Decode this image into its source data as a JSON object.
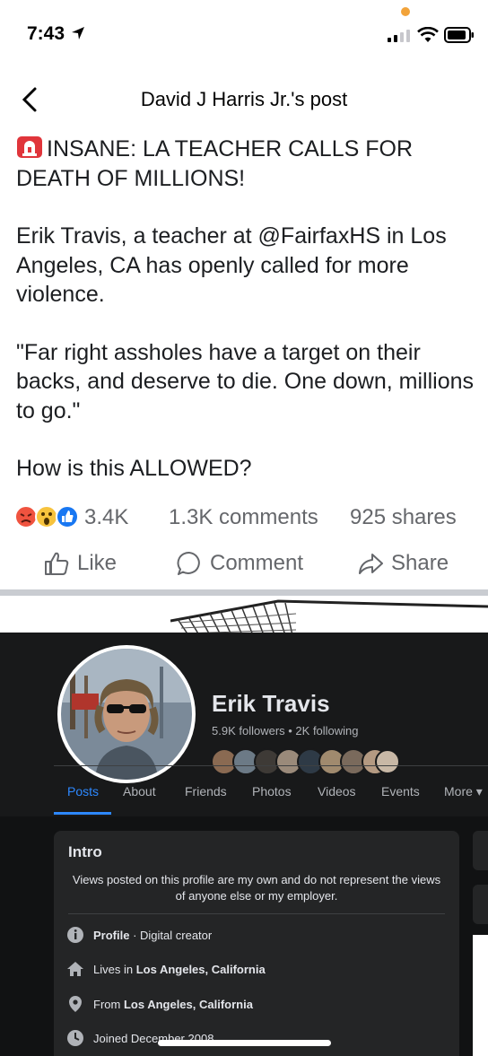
{
  "status_bar": {
    "time": "7:43"
  },
  "header": {
    "title": "David J Harris Jr.'s post"
  },
  "post": {
    "headline": "INSANE:  LA TEACHER CALLS FOR DEATH OF MILLIONS!",
    "paragraph1": "Erik Travis, a teacher at @FairfaxHS in Los Angeles, CA has openly called for more violence.",
    "paragraph2": "\"Far right assholes have a target on their backs, and deserve to die. One down, millions to go.\"",
    "paragraph3": "How is this ALLOWED?"
  },
  "stats": {
    "reactions": "3.4K",
    "comments": "1.3K comments",
    "shares": "925 shares"
  },
  "actions": {
    "like": "Like",
    "comment": "Comment",
    "share": "Share"
  },
  "embedded_profile": {
    "name": "Erik Travis",
    "followers": "5.9K followers • 2K following",
    "tabs": [
      "Posts",
      "About",
      "Friends",
      "Photos",
      "Videos",
      "Events",
      "More ▾"
    ],
    "active_tab": "Posts",
    "intro": {
      "title": "Intro",
      "bio": "Views posted on this profile are my own and do not represent the views of anyone else or my employer.",
      "profile_label": "Profile",
      "profile_value": " · Digital creator",
      "lives_label": "Lives in ",
      "lives_value": "Los Angeles, California",
      "from_label": "From ",
      "from_value": "Los Angeles, California",
      "joined": "Joined December 2008"
    }
  },
  "colors": {
    "fb_blue": "#1877f2",
    "dark_bg": "#18191a",
    "card_bg": "#242526",
    "tab_active": "#2d88ff"
  }
}
